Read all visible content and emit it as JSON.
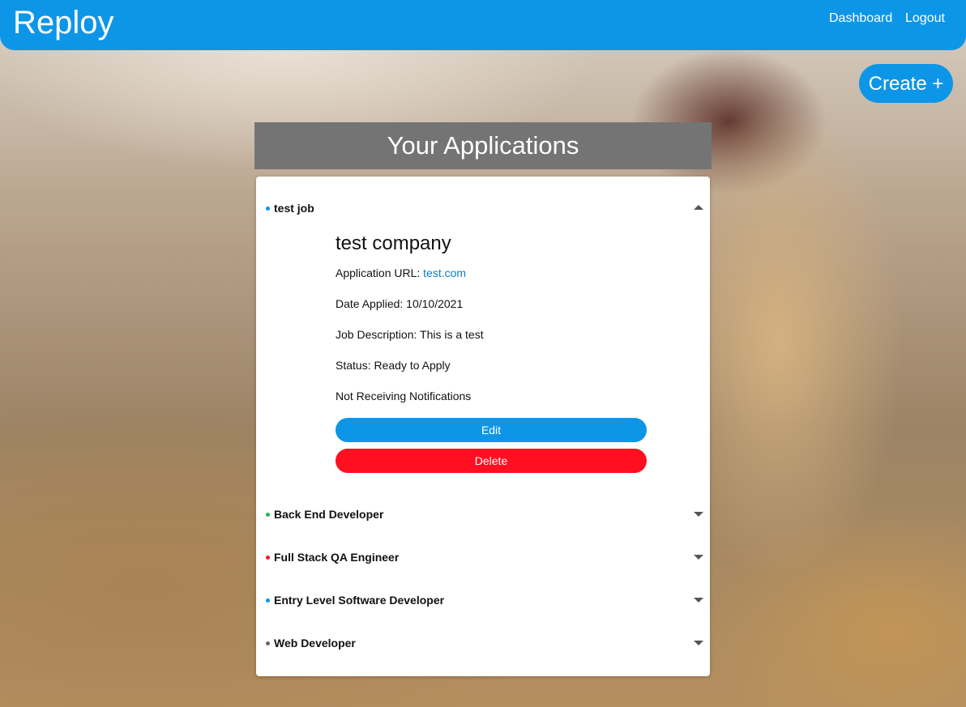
{
  "header": {
    "brand": "Reploy",
    "nav": {
      "dashboard": "Dashboard",
      "logout": "Logout"
    }
  },
  "create_button": "Create +",
  "page_title": "Your Applications",
  "applications": [
    {
      "title": "test job",
      "status_color": "#0d96e8",
      "expanded": true,
      "company": "test company",
      "url_label": "Application URL: ",
      "url": "test.com",
      "date_applied": "Date Applied: 10/10/2021",
      "job_description": "Job Description: This is a test",
      "status": "Status: Ready to Apply",
      "notifications": "Not Receiving Notifications",
      "edit_label": "Edit",
      "delete_label": "Delete"
    },
    {
      "title": "Back End Developer",
      "status_color": "#1db954",
      "expanded": false
    },
    {
      "title": "Full Stack QA Engineer",
      "status_color": "#ff0f20",
      "expanded": false
    },
    {
      "title": "Entry Level Software Developer",
      "status_color": "#0d96e8",
      "expanded": false
    },
    {
      "title": "Web Developer",
      "status_color": "#666666",
      "expanded": false
    }
  ],
  "colors": {
    "primary": "#0d96e8",
    "danger": "#ff0f20",
    "title_bar": "#747474"
  }
}
